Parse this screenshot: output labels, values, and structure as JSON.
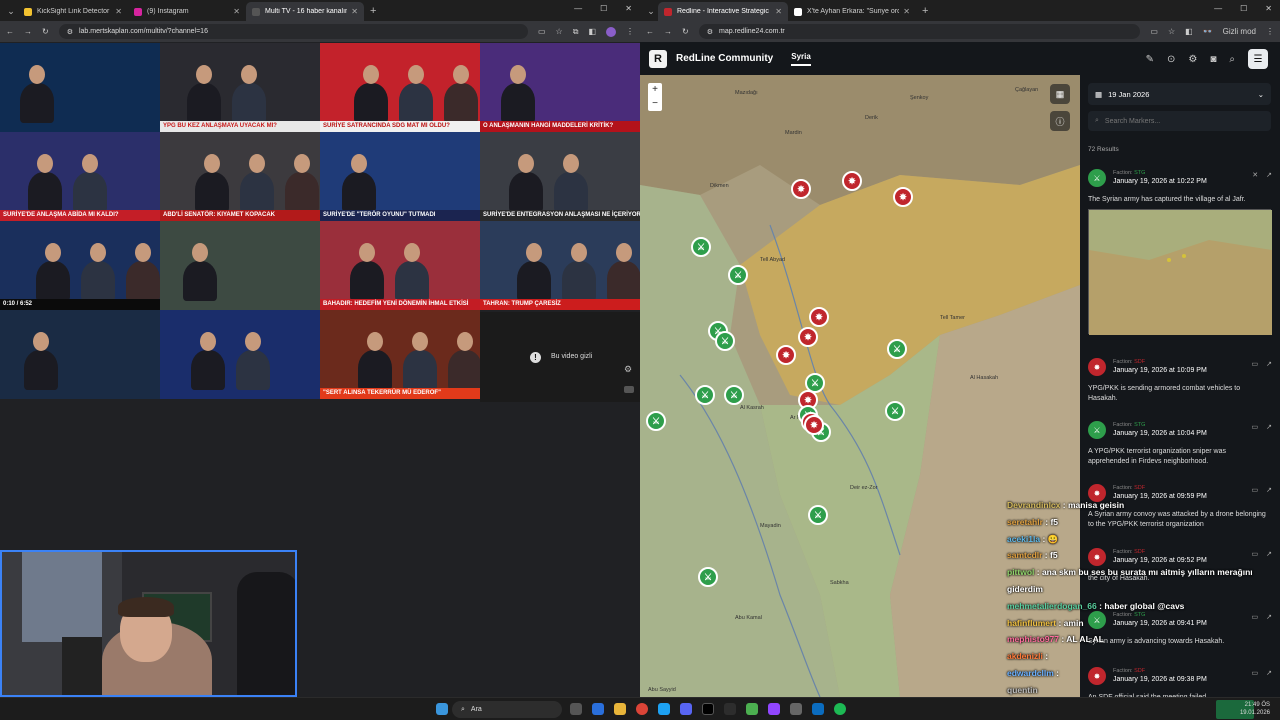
{
  "left_browser": {
    "tabs": [
      {
        "title": "KickSight Link Detector",
        "active": false,
        "color": "#f2c230"
      },
      {
        "title": "(9) Instagram",
        "active": false,
        "color": "#d6249f"
      },
      {
        "title": "Multi TV - 16 haber kanalını ay",
        "active": true,
        "color": "#444444"
      }
    ],
    "url": "lab.mertskaplan.com/multitv/?channel=16",
    "tiles": [
      {
        "ticker": "",
        "bg": "#0f2c52",
        "tbg": "#0a1a33",
        "tc": "#fff"
      },
      {
        "ticker": "YPG BU KEZ ANLAŞMAYA UYACAK MI?",
        "bg": "#2a2a30",
        "tbg": "#e8e8e8",
        "tc": "#c81a1a"
      },
      {
        "ticker": "SURİYE SATRANCINDA SDG MAT MI OLDU?",
        "bg": "#c3222b",
        "tbg": "#f0f0f0",
        "tc": "#b11"
      },
      {
        "ticker": "O ANLAŞMANIN HANGİ MADDELERİ KRİTİK?",
        "bg": "#4a2c7a",
        "tbg": "#b3121b",
        "tc": "#fff"
      },
      {
        "ticker": "SURİYE'DE ANLAŞMA ABİDA MI KALDI?",
        "bg": "#2b2f6a",
        "tbg": "#c41e27",
        "tc": "#fff"
      },
      {
        "ticker": "ABD'Lİ SENATÖR: KIYAMET KOPACAK",
        "bg": "#3c3a3e",
        "tbg": "#b21a1a",
        "tc": "#fff"
      },
      {
        "ticker": "SURİYE'DE \"TERÖR OYUNU\" TUTMADI",
        "bg": "#1f3b78",
        "tbg": "#1b2450",
        "tc": "#fff"
      },
      {
        "ticker": "SURİYE'DE ENTEGRASYON ANLAŞMASI NE İÇERİYOR?",
        "bg": "#3a3d44",
        "tbg": "#2a2a2a",
        "tc": "#fff"
      },
      {
        "ticker": "0:10 / 6:52",
        "bg": "#1a2f5c",
        "tbg": "#0b0b0b",
        "tc": "#fff"
      },
      {
        "ticker": "",
        "bg": "#3d4a42",
        "tbg": "#2a2a2a",
        "tc": "#fff"
      },
      {
        "ticker": "BAHADIR: HEDEFİM YENİ DÖNEMİN İHMAL ETKİSİ",
        "bg": "#9a2f3b",
        "tbg": "#c31c24",
        "tc": "#fff"
      },
      {
        "ticker": "TAHRAN: TRUMP ÇARESİZ",
        "bg": "#2b3c5a",
        "tbg": "#cc1d1d",
        "tc": "#fff"
      },
      {
        "ticker": "",
        "bg": "#1a2b44",
        "tbg": "#0d1a2d",
        "tc": "#6f6"
      },
      {
        "ticker": "",
        "bg": "#1a2d6b",
        "tbg": "#c8102e",
        "tc": "#fff"
      },
      {
        "ticker": "\"SERT ALINSA TEKERRÜR MÜ EDEROF\"",
        "bg": "#6b2a1c",
        "tbg": "#e23a1a",
        "tc": "#fff"
      }
    ],
    "hidden_video_text": "Bu video gizli"
  },
  "right_browser": {
    "tabs": [
      {
        "title": "Redline - Interactive Strategic M",
        "active": true,
        "color": "#c0262d"
      },
      {
        "title": "X'te Ayhan Erkara: \"Suriye ordu",
        "active": false,
        "color": "#ffffff"
      }
    ],
    "url": "map.redline24.com.tr",
    "incognito_label": "Gizli mod",
    "brand": "RedLine Community",
    "nav_item": "Syria",
    "date": "19 Jan 2026",
    "search_placeholder": "Search Markers...",
    "results": "72 Results",
    "events": [
      {
        "faction": "STG",
        "date": "January 19, 2026 at 10:22 PM",
        "text": "The Syrian army has captured the village of al Jafr.",
        "side": "g"
      },
      {
        "faction": "SDF",
        "date": "January 19, 2026 at 10:09 PM",
        "text": "YPG/PKK is sending armored combat vehicles to Hasakah.",
        "side": "r"
      },
      {
        "faction": "STG",
        "date": "January 19, 2026 at 10:04 PM",
        "text": "A YPG/PKK terrorist organization sniper was apprehended in Firdevs neighborhood.",
        "side": "g"
      },
      {
        "faction": "SDF",
        "date": "January 19, 2026 at 09:59 PM",
        "text": "A Syrian army convoy was attacked by a drone belonging to the YPG/PKK terrorist organization",
        "side": "r"
      },
      {
        "faction": "SDF",
        "date": "January 19, 2026 at 09:52 PM",
        "text": "the city of Hasakah.",
        "side": "r"
      },
      {
        "faction": "STG",
        "date": "January 19, 2026 at 09:41 PM",
        "text": "Syrian army is advancing towards Hasakah.",
        "side": "g"
      },
      {
        "faction": "SDF",
        "date": "January 19, 2026 at 09:38 PM",
        "text": "An SDF official said the meeting failed",
        "side": "r"
      }
    ],
    "map_labels": [
      "Mardin",
      "Dikmen",
      "Tell Abyad",
      "Mazıdağı",
      "Derik",
      "Şenkoy",
      "Çağlayan",
      "Ar Raqqah",
      "Deir ez-Zor",
      "Al Hasakah",
      "Tell Tamer",
      "Abu Kamal",
      "Sabkha",
      "Al Kasrah",
      "Mayadin",
      "Abu Sayyid"
    ]
  },
  "chat": [
    {
      "user": "Devrandinlcx",
      "msg": ": manisa geisin",
      "color": "#d3b95c"
    },
    {
      "user": "seretahlr",
      "msg": ": f5",
      "color": "#e0a040"
    },
    {
      "user": "aceki1la",
      "msg": ": 😀",
      "color": "#5fb8e8"
    },
    {
      "user": "samtcdlr",
      "msg": ": f5",
      "color": "#e0a040"
    },
    {
      "user": "pittwol",
      "msg": ": ana skm bu ses bu surata mı aitmiş yılların merağını",
      "color": "#8fd36a"
    },
    {
      "user": "",
      "msg": "giderdim",
      "color": "#ffffff"
    },
    {
      "user": "mehmetalierdogan_66",
      "msg": ": haber global @cavs",
      "color": "#5ad0a0"
    },
    {
      "user": "hafinflumert",
      "msg": ": amin",
      "color": "#f0c040"
    },
    {
      "user": "mephisto977",
      "msg": ": AL AL AL",
      "color": "#ff6b9d"
    },
    {
      "user": "akdenizli",
      "msg": ":",
      "color": "#ff7a3a"
    },
    {
      "user": "edwardcllm",
      "msg": ":",
      "color": "#6ab0ff"
    },
    {
      "user": "quentin",
      "msg": "",
      "color": "#bbbbbb"
    }
  ],
  "taskbar": {
    "search": "Ara",
    "time": "21:49 ÖS",
    "date": "19.01.2026"
  }
}
